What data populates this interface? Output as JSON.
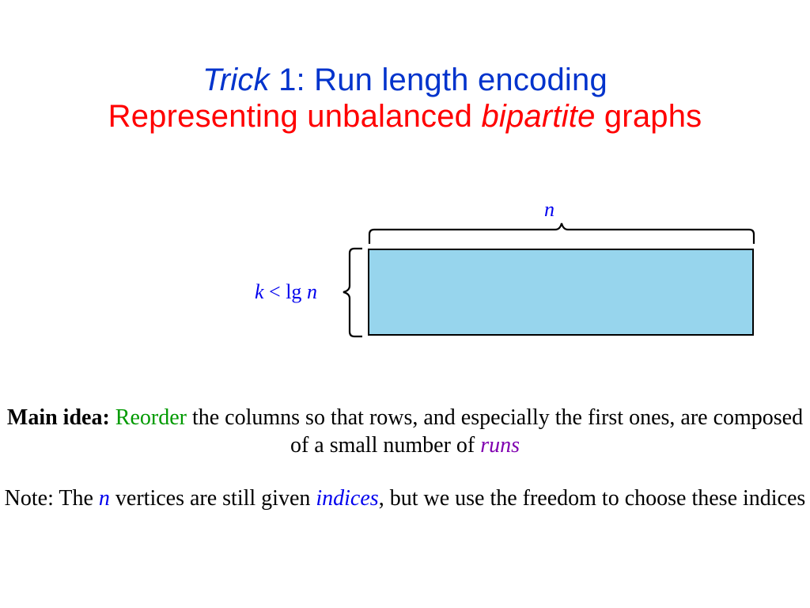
{
  "title": {
    "trick_word": "Trick",
    "trick_rest": " 1: Run length encoding",
    "line2_pre": "Representing unbalanced ",
    "line2_it": "bipartite",
    "line2_post": " graphs"
  },
  "diagram": {
    "n_label": "n",
    "k_prefix": "k",
    "k_mid": " < lg",
    "k_suffix": "n"
  },
  "main": {
    "label": "Main idea:",
    "reorder": " Reorder",
    "rest1": " the columns so that rows, and especially the first ones, are composed of a small number of ",
    "runs": "runs"
  },
  "note": {
    "pre": "Note: The ",
    "n": "n",
    "mid": " vertices are still given ",
    "indices": "indices",
    "post1": ", but we use the freedom to choose these indices"
  }
}
